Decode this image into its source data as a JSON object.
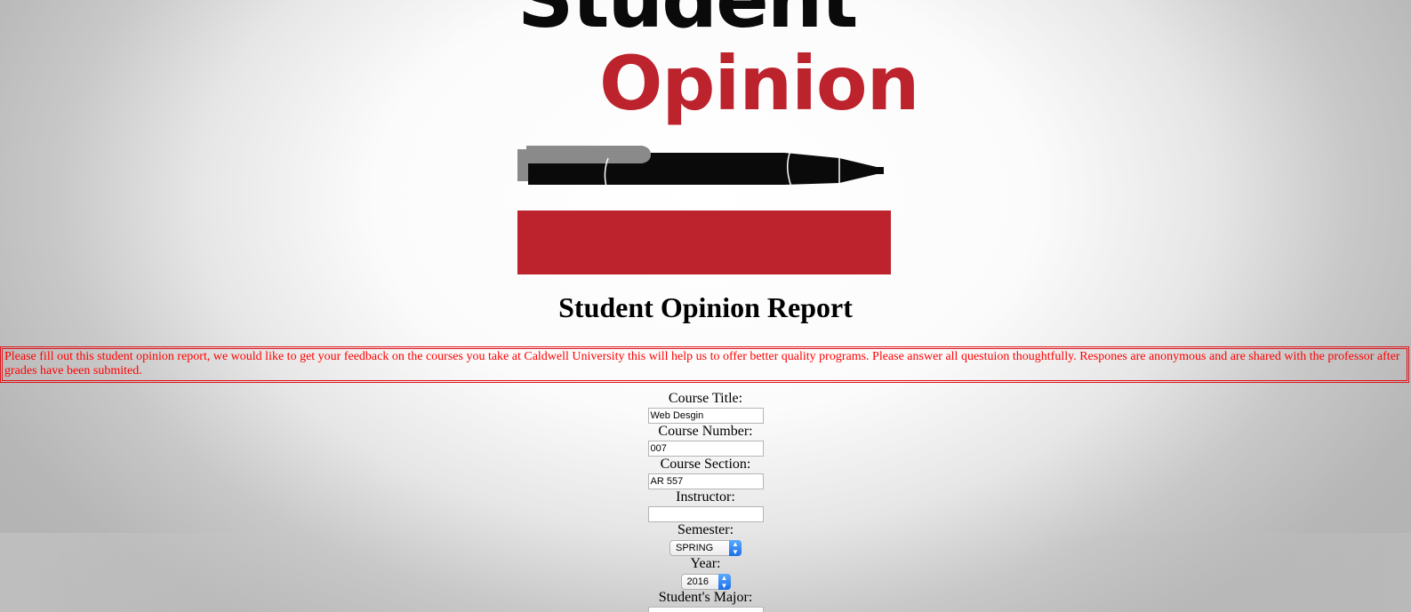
{
  "logo": {
    "word1": "Student",
    "word2": "Opinion",
    "colors": {
      "red": "#bc232d",
      "black": "#0a0a0a",
      "pen_cap": "#8a8a8a"
    }
  },
  "page": {
    "title": "Student Opinion Report",
    "notice": "Please fill out this student opinion report, we would like to get your feedback on the courses you take at Caldwell University this will help us to offer better quality programs. Please answer all questuion thoughtfully. Respones are anonymous and are shared with the professor after grades have been submited.",
    "notice_color": "#ff0000"
  },
  "form": {
    "course_title": {
      "label": "Course Title:",
      "value": "Web Desgin"
    },
    "course_number": {
      "label": "Course Number:",
      "value": "007"
    },
    "course_section": {
      "label": "Course Section:",
      "value": "AR 557"
    },
    "instructor": {
      "label": "Instructor:",
      "value": ""
    },
    "semester": {
      "label": "Semester:",
      "selected": "SPRING"
    },
    "year": {
      "label": "Year:",
      "selected": "2016"
    },
    "major": {
      "label": "Student's Major:",
      "value": ""
    }
  },
  "icons": {
    "select_arrow": "updown-chevron-icon",
    "logo_pen": "pen-icon"
  }
}
